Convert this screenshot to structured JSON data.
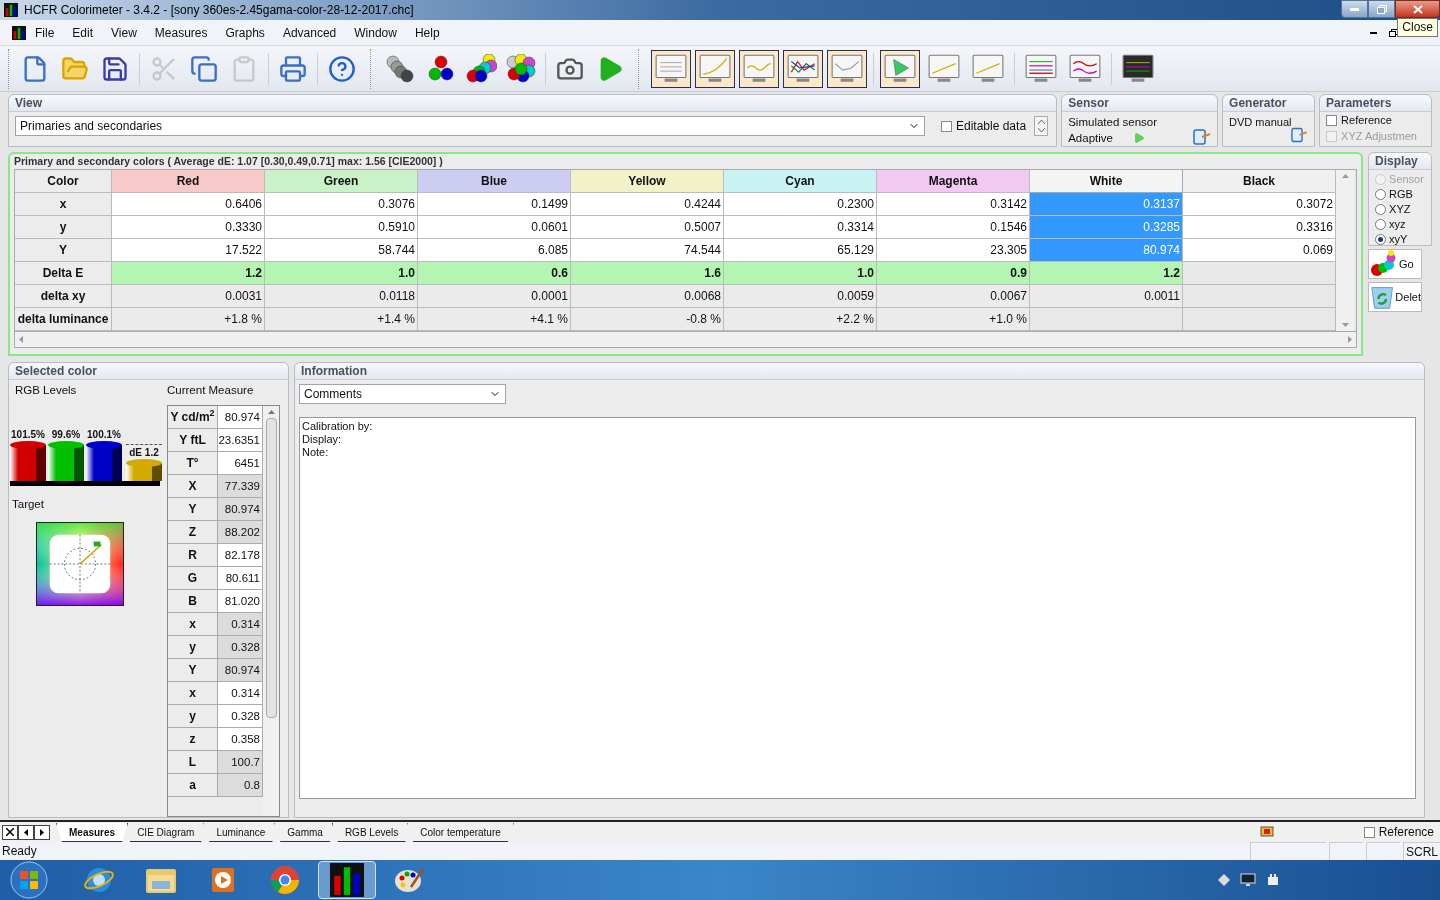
{
  "window": {
    "title": "HCFR Colorimeter - 3.4.2 - [sony 360es-2.45gama-color-28-12-2017.chc]",
    "tooltip": "Close"
  },
  "menu": [
    "File",
    "Edit",
    "View",
    "Measures",
    "Graphs",
    "Advanced",
    "Window",
    "Help"
  ],
  "toolbar": [
    {
      "kind": "new",
      "disabled": false
    },
    {
      "kind": "open",
      "disabled": false
    },
    {
      "kind": "save",
      "disabled": false
    },
    {
      "kind": "sep"
    },
    {
      "kind": "cut",
      "disabled": true
    },
    {
      "kind": "copy",
      "disabled": false
    },
    {
      "kind": "paste",
      "disabled": true
    },
    {
      "kind": "sep"
    },
    {
      "kind": "print",
      "disabled": false
    },
    {
      "kind": "sep"
    },
    {
      "kind": "help",
      "disabled": false
    },
    {
      "kind": "bigsep"
    },
    {
      "kind": "grays",
      "disabled": false
    },
    {
      "kind": "primaries",
      "disabled": false
    },
    {
      "kind": "secondaries",
      "disabled": false
    },
    {
      "kind": "all",
      "disabled": false
    },
    {
      "kind": "sep"
    },
    {
      "kind": "camera",
      "disabled": false
    },
    {
      "kind": "play",
      "disabled": false
    },
    {
      "kind": "bigsep"
    }
  ],
  "graph_buttons": [
    {
      "kind": "table",
      "selected": true
    },
    {
      "kind": "curve",
      "selected": true
    },
    {
      "kind": "wave",
      "selected": true
    },
    {
      "kind": "multi",
      "selected": true
    },
    {
      "kind": "line",
      "selected": true
    },
    {
      "kind": "sep"
    },
    {
      "kind": "cie",
      "selected": true
    },
    {
      "kind": "rise",
      "selected": false
    },
    {
      "kind": "rise",
      "selected": false
    },
    {
      "kind": "sep"
    },
    {
      "kind": "bands",
      "selected": false
    },
    {
      "kind": "waves",
      "selected": false
    },
    {
      "kind": "sep"
    },
    {
      "kind": "dark",
      "selected": false
    }
  ],
  "view": {
    "title": "View",
    "select": "Primaries and secondaries",
    "editable": {
      "label": "Editable data",
      "checked": false
    }
  },
  "sensor": {
    "title": "Sensor",
    "name": "Simulated sensor",
    "mode": "Adaptive"
  },
  "generator": {
    "title": "Generator",
    "name": "DVD manual"
  },
  "parameters": {
    "title": "Parameters",
    "options": [
      {
        "label": "Reference",
        "checked": false,
        "disabled": false
      },
      {
        "label": "XYZ Adjustmen",
        "checked": false,
        "disabled": true
      }
    ]
  },
  "table": {
    "caption": "Primary and secondary colors ( Average dE: 1.07 [0.30,0.49,0.71] max: 1.56 [CIE2000] )",
    "columns": [
      {
        "label": "Color",
        "selected": false
      },
      {
        "label": "Red",
        "color": "#f7c9c9",
        "selected": false
      },
      {
        "label": "Green",
        "color": "#c9f2c9",
        "selected": false
      },
      {
        "label": "Blue",
        "color": "#cdcdf2",
        "selected": false
      },
      {
        "label": "Yellow",
        "color": "#f2f2c9",
        "selected": false
      },
      {
        "label": "Cyan",
        "color": "#c9f2f2",
        "selected": false
      },
      {
        "label": "Magenta",
        "color": "#f2c9f2",
        "selected": false
      },
      {
        "label": "White",
        "color": "#f4f4f4",
        "selected": true
      },
      {
        "label": "Black",
        "color": "#f0f0f0",
        "selected": false
      }
    ],
    "rows": [
      {
        "kind": "value",
        "label": "x",
        "cells": [
          "0.6406",
          "0.3076",
          "0.1499",
          "0.4244",
          "0.2300",
          "0.3142",
          "0.3137",
          "0.3072"
        ]
      },
      {
        "kind": "value",
        "label": "y",
        "cells": [
          "0.3330",
          "0.5910",
          "0.0601",
          "0.5007",
          "0.3314",
          "0.1546",
          "0.3285",
          "0.3316"
        ]
      },
      {
        "kind": "value",
        "label": "Y",
        "cells": [
          "17.522",
          "58.744",
          "6.085",
          "74.544",
          "65.129",
          "23.305",
          "80.974",
          "0.069"
        ]
      },
      {
        "kind": "delta",
        "label": "Delta E",
        "cells": [
          "1.2",
          "1.0",
          "0.6",
          "1.6",
          "1.0",
          "0.9",
          "1.2"
        ]
      },
      {
        "kind": "stat",
        "label": "delta xy",
        "cells": [
          "0.0031",
          "0.0118",
          "0.0001",
          "0.0068",
          "0.0059",
          "0.0067",
          "0.0011"
        ]
      },
      {
        "kind": "stat",
        "label": "delta luminance",
        "cells": [
          "+1.8 %",
          "+1.4 %",
          "+4.1 %",
          "-0.8 %",
          "+2.2 %",
          "+1.0 %"
        ]
      }
    ]
  },
  "display": {
    "title": "Display",
    "options": [
      {
        "label": "Sensor",
        "selected": false,
        "disabled": true
      },
      {
        "label": "RGB",
        "selected": false,
        "disabled": false
      },
      {
        "label": "XYZ",
        "selected": false,
        "disabled": false
      },
      {
        "label": "xyz",
        "selected": false,
        "disabled": false
      },
      {
        "label": "xyY",
        "selected": true,
        "disabled": false
      }
    ],
    "buttons": [
      {
        "kind": "go",
        "label": "Go"
      },
      {
        "kind": "delete",
        "label": "Delet"
      }
    ]
  },
  "selected_color": {
    "title": "Selected color",
    "levels_label": "RGB Levels",
    "measure_label": "Current Measure",
    "levels": [
      {
        "label": "101.5%",
        "color": "#d00000"
      },
      {
        "label": "99.6%",
        "color": "#00c000"
      },
      {
        "label": "100.1%",
        "color": "#0000c8"
      }
    ],
    "delta": "dE 1.2",
    "target_label": "Target",
    "measures": [
      {
        "label": "Y cd/m$^{2}$",
        "value": "80.974",
        "shaded": false
      },
      {
        "label": "Y ftL",
        "value": "23.6351",
        "shaded": false
      },
      {
        "label": "T°",
        "value": "6451",
        "shaded": false
      },
      {
        "label": "X",
        "value": "77.339",
        "shaded": true
      },
      {
        "label": "Y",
        "value": "80.974",
        "shaded": true
      },
      {
        "label": "Z",
        "value": "88.202",
        "shaded": true
      },
      {
        "label": "R",
        "value": "82.178",
        "shaded": false
      },
      {
        "label": "G",
        "value": "80.611",
        "shaded": false
      },
      {
        "label": "B",
        "value": "81.020",
        "shaded": false
      },
      {
        "label": "x",
        "value": "0.314",
        "shaded": true
      },
      {
        "label": "y",
        "value": "0.328",
        "shaded": true
      },
      {
        "label": "Y",
        "value": "80.974",
        "shaded": true
      },
      {
        "label": "x",
        "value": "0.314",
        "shaded": false
      },
      {
        "label": "y",
        "value": "0.328",
        "shaded": false
      },
      {
        "label": "z",
        "value": "0.358",
        "shaded": false
      },
      {
        "label": "L",
        "value": "100.7",
        "shaded": true
      },
      {
        "label": "a",
        "value": "0.8",
        "shaded": true
      }
    ]
  },
  "information": {
    "title": "Information",
    "select": "Comments",
    "lines": [
      "Calibration by:",
      "Display:",
      "Note:"
    ]
  },
  "tabs": [
    {
      "label": "Measures",
      "selected": true
    },
    {
      "label": "CIE Diagram",
      "selected": false
    },
    {
      "label": "Luminance",
      "selected": false
    },
    {
      "label": "Gamma",
      "selected": false
    },
    {
      "label": "RGB Levels",
      "selected": false
    },
    {
      "label": "Color temperature",
      "selected": false
    }
  ],
  "bottom_reference": {
    "label": "Reference",
    "checked": false
  },
  "status_bar": {
    "text": "Ready",
    "indicator": "SCRL"
  },
  "taskbar": [
    {
      "kind": "start",
      "selected": false
    },
    {
      "kind": "browser",
      "selected": false
    },
    {
      "kind": "folder",
      "selected": false
    },
    {
      "kind": "media",
      "selected": false
    },
    {
      "kind": "chrome",
      "selected": false
    },
    {
      "kind": "hcfr",
      "selected": true
    },
    {
      "kind": "paint",
      "selected": false
    }
  ]
}
